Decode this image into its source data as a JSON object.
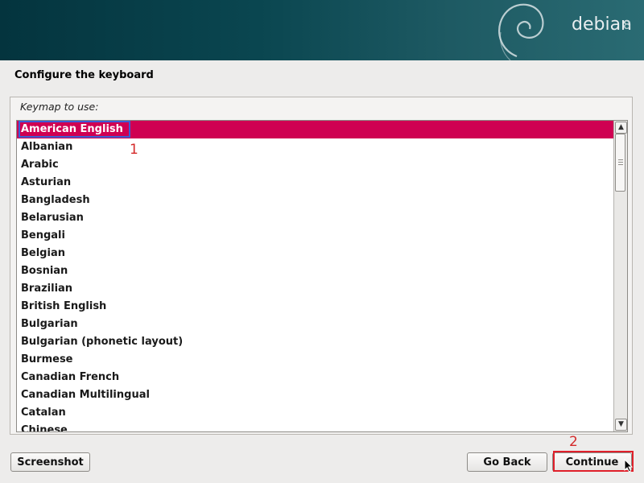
{
  "banner": {
    "brand": "debian",
    "version": "8",
    "logo_icon": "debian-swirl-icon"
  },
  "page": {
    "title": "Configure the keyboard"
  },
  "keymap": {
    "label": "Keymap to use:",
    "selected": "American English",
    "items": [
      "American English",
      "Albanian",
      "Arabic",
      "Asturian",
      "Bangladesh",
      "Belarusian",
      "Bengali",
      "Belgian",
      "Bosnian",
      "Brazilian",
      "British English",
      "Bulgarian",
      "Bulgarian (phonetic layout)",
      "Burmese",
      "Canadian French",
      "Canadian Multilingual",
      "Catalan",
      "Chinese"
    ]
  },
  "scrollbar": {
    "up_icon": "scroll-up-arrow-icon",
    "down_icon": "scroll-down-arrow-icon"
  },
  "buttons": {
    "screenshot": "Screenshot",
    "go_back": "Go Back",
    "continue": "Continue"
  },
  "annotations": {
    "marker_1": "1",
    "marker_2": "2",
    "color": "#d42a2a"
  },
  "colors": {
    "selection": "#cf0052",
    "banner": "#0a4650"
  }
}
